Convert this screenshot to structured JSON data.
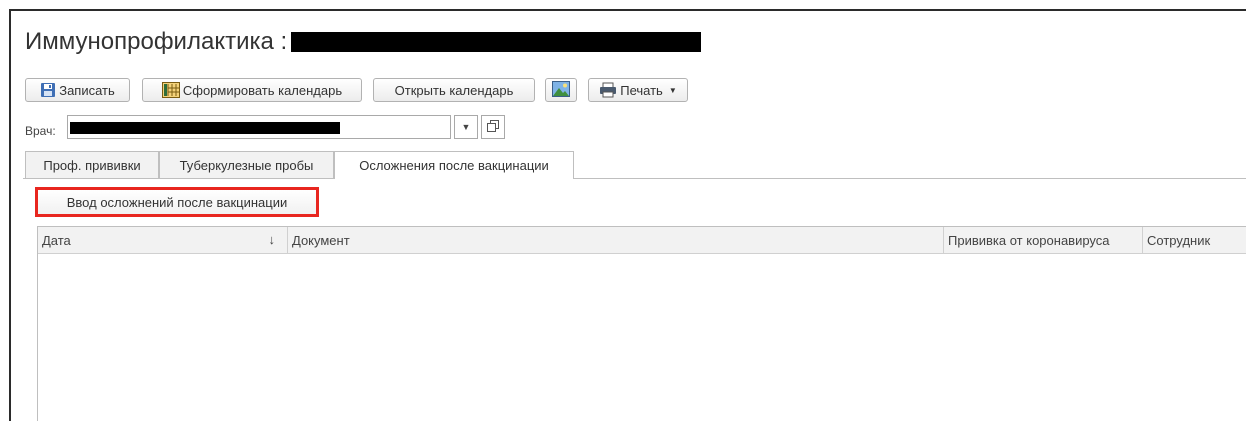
{
  "window": {
    "title": "Иммунопрофилактика :"
  },
  "toolbar": {
    "save_label": "Записать",
    "build_calendar_label": "Сформировать календарь",
    "open_calendar_label": "Открыть календарь",
    "print_label": "Печать"
  },
  "doctor": {
    "label": "Врач:"
  },
  "tabs": [
    {
      "label": "Проф. прививки"
    },
    {
      "label": "Туберкулезные пробы"
    },
    {
      "label": "Осложнения после вакцинации"
    }
  ],
  "actions": {
    "enter_complications_label": "Ввод осложнений после вакцинации"
  },
  "table": {
    "columns": [
      {
        "label": "Дата",
        "sort": "↓"
      },
      {
        "label": "Документ"
      },
      {
        "label": "Прививка от коронавируса"
      },
      {
        "label": "Сотрудник"
      }
    ],
    "rows": []
  },
  "colors": {
    "highlight": "#e8261f",
    "border": "#bfbfbf",
    "tab_inactive_bg": "#f2f2f2"
  }
}
